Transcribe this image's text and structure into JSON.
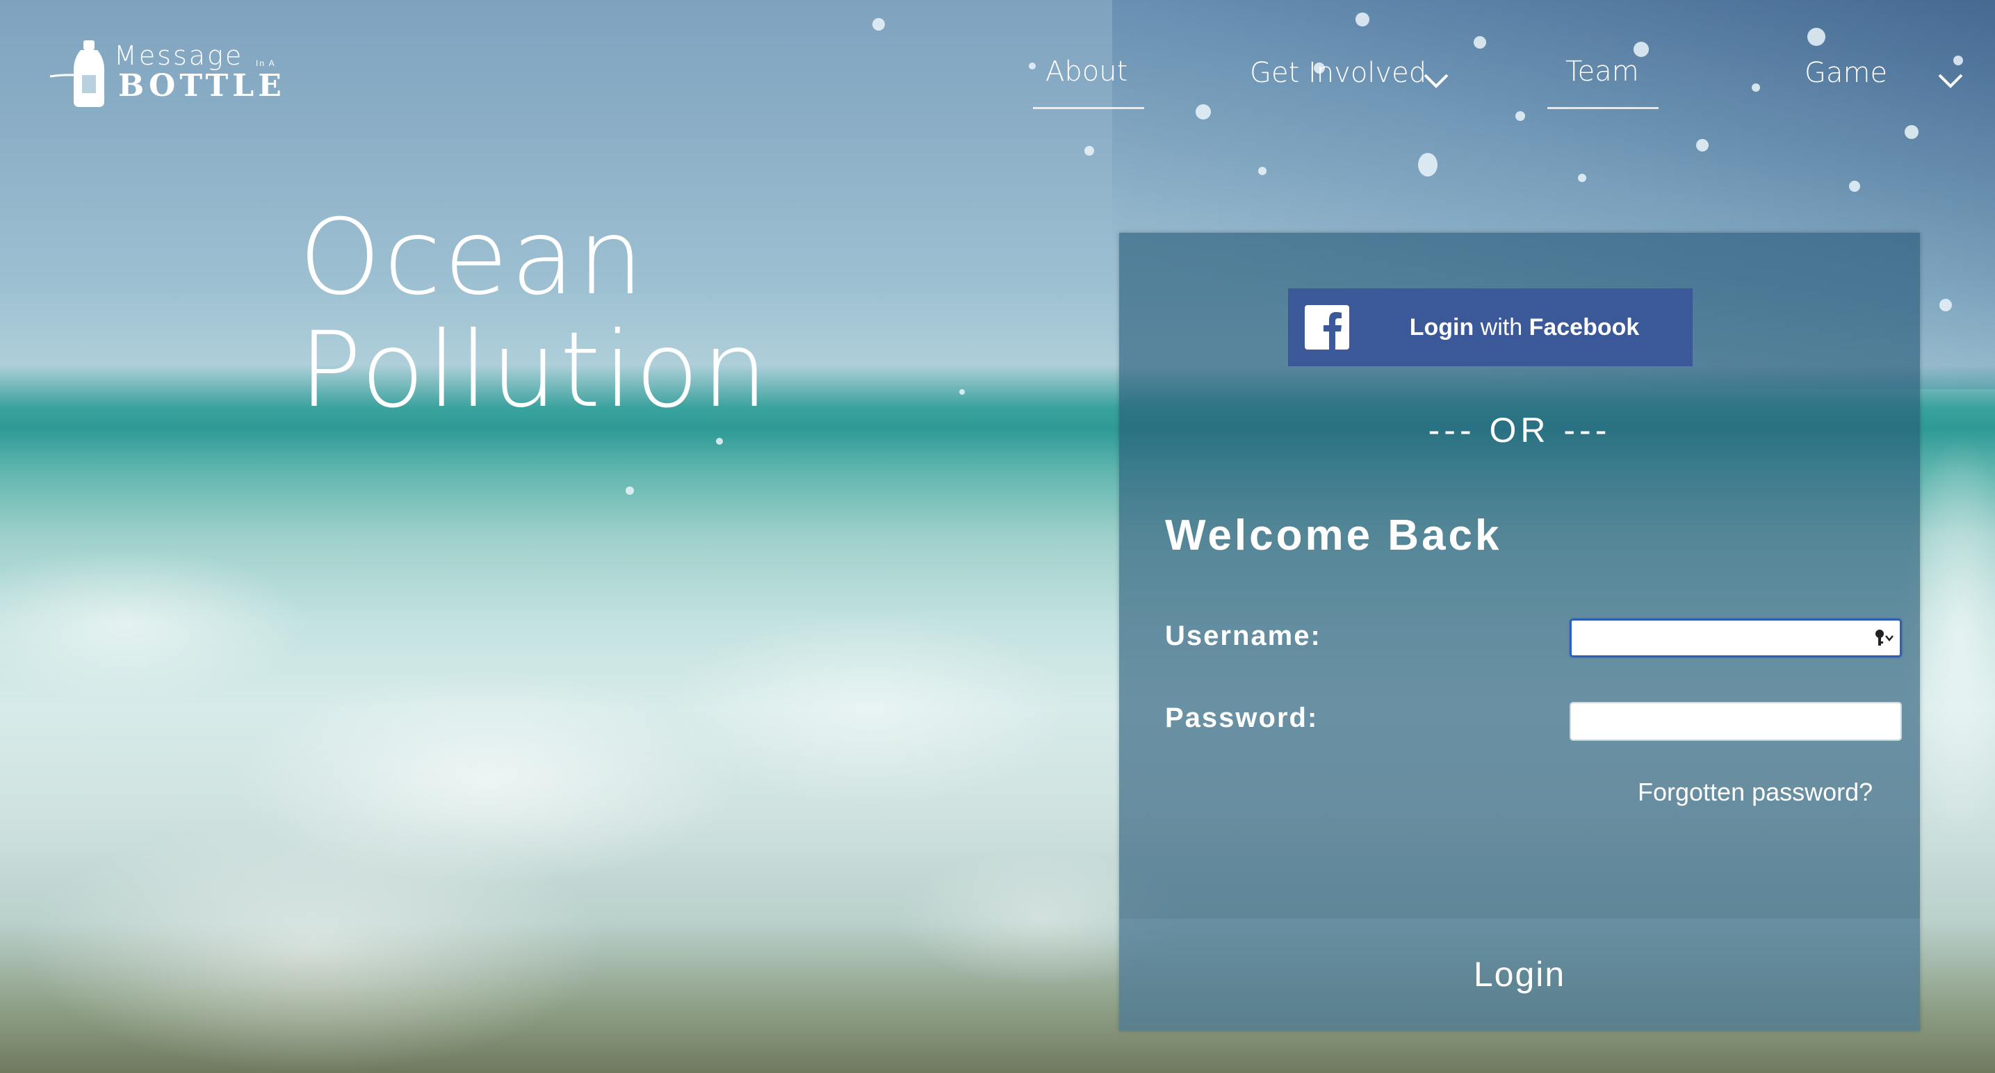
{
  "logo": {
    "line1": "Message",
    "small": "In A",
    "line2": "BOTTLE"
  },
  "nav": {
    "items": [
      {
        "label": "About",
        "has_dropdown": false,
        "underlined": true
      },
      {
        "label": "Get Involved",
        "has_dropdown": true,
        "underlined": false
      },
      {
        "label": "Team",
        "has_dropdown": false,
        "underlined": true
      },
      {
        "label": "Game",
        "has_dropdown": true,
        "underlined": false
      }
    ]
  },
  "hero": {
    "line1": "Ocean",
    "line2": "Pollution"
  },
  "login": {
    "facebook": {
      "login_word": "Login",
      "with_word": "with",
      "brand_word": "Facebook"
    },
    "divider": "--- OR ---",
    "heading": "Welcome Back",
    "username_label": "Username:",
    "username_value": "",
    "password_label": "Password:",
    "password_value": "",
    "forgot_link": "Forgotten password?",
    "submit_label": "Login"
  },
  "colors": {
    "facebook_blue": "#3b5998",
    "panel": "#26587a",
    "text": "#ffffff",
    "focus_ring": "#2f5fb4"
  },
  "icons": {
    "logo": "bottle-icon",
    "facebook": "facebook-icon",
    "dropdown": "chevron-down-icon",
    "password_manager": "key-icon"
  }
}
